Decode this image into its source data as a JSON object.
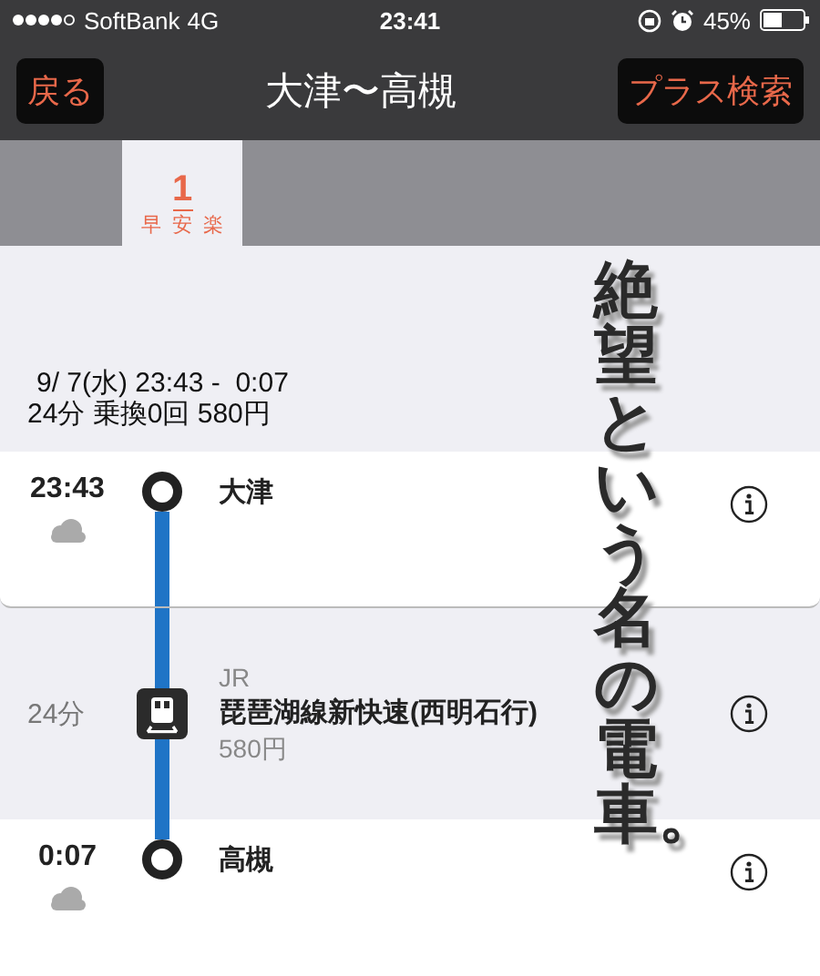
{
  "status_bar": {
    "carrier": "SoftBank",
    "network": "4G",
    "time": "23:41",
    "battery": "45%"
  },
  "nav": {
    "back": "戻る",
    "title": "大津〜高槻",
    "action": "プラス検索"
  },
  "tabs": [
    {
      "number": "1",
      "selected": true,
      "ranks": [
        {
          "label": "早",
          "marked": false
        },
        {
          "label": "安",
          "marked": true
        },
        {
          "label": "楽",
          "marked": false
        }
      ]
    }
  ],
  "summary": {
    "times": "9/ 7(水) 23:43 -  0:07",
    "details": "24分 乗換0回 580円"
  },
  "route": [
    {
      "kind": "station",
      "time": "23:43",
      "name": "大津"
    },
    {
      "kind": "ride",
      "duration": "24分",
      "operator": "JR",
      "line": "琵琶湖線新快速(西明石行)",
      "fare": "580円"
    },
    {
      "kind": "station",
      "time": "0:07",
      "name": "高槻"
    }
  ],
  "overlay": {
    "text": "絶望という名の電車。"
  }
}
